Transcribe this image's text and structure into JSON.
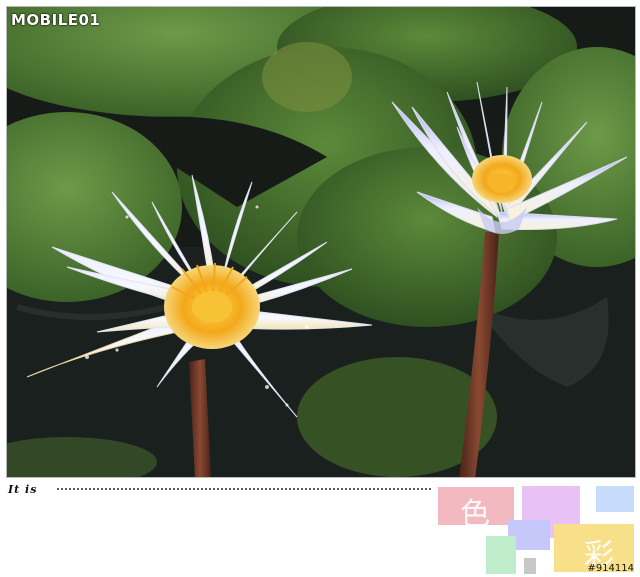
{
  "branding": {
    "logo_text": "MOBILE01",
    "logo_icon": "mobile01-logo-icon"
  },
  "caption": {
    "label": "It is"
  },
  "decoration": {
    "char_color": "色",
    "char_vivid": "彩"
  },
  "footer": {
    "photo_id": "#914114"
  },
  "colors": {
    "leaf": "#4f7a34",
    "water": "#151a17",
    "petal": "#f4f5ff",
    "petal_tint": "#b7bdf0",
    "stamen": "#f3b21c",
    "stem": "#6a3424"
  },
  "image": {
    "subject": "two-water-lilies-with-lily-pads",
    "icons": [
      "water-lily-flower",
      "lily-pad-leaf",
      "water-droplets"
    ]
  }
}
